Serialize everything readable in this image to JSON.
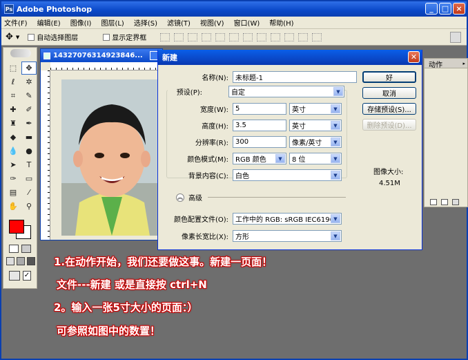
{
  "app": {
    "title": "Adobe Photoshop",
    "window_buttons": [
      "_",
      "□",
      "×"
    ]
  },
  "menu": [
    "文件(F)",
    "编辑(E)",
    "图像(I)",
    "图层(L)",
    "选择(S)",
    "滤镜(T)",
    "视图(V)",
    "窗口(W)",
    "帮助(H)"
  ],
  "options": {
    "auto_select": "自动选择图层",
    "show_bounds": "显示定界框"
  },
  "document": {
    "title": "14327076314923846..."
  },
  "panel": {
    "tab": "动作"
  },
  "dialog": {
    "title": "新建",
    "name_label": "名称(N):",
    "name_value": "未标题-1",
    "preset_label": "预设(P):",
    "preset_value": "自定",
    "width_label": "宽度(W):",
    "width_value": "5",
    "width_unit": "英寸",
    "height_label": "高度(H):",
    "height_value": "3.5",
    "height_unit": "英寸",
    "res_label": "分辨率(R):",
    "res_value": "300",
    "res_unit": "像素/英寸",
    "mode_label": "颜色模式(M):",
    "mode_value": "RGB 颜色",
    "mode_bits": "8 位",
    "bg_label": "背景内容(C):",
    "bg_value": "白色",
    "advanced_label": "高级",
    "profile_label": "颜色配置文件(O):",
    "profile_value": "工作中的 RGB: sRGB IEC6196...",
    "aspect_label": "像素长宽比(X):",
    "aspect_value": "方形",
    "ok": "好",
    "cancel": "取消",
    "save_preset": "存储预设(S)...",
    "delete_preset": "删除预设(D)...",
    "image_size_label": "图像大小:",
    "image_size_value": "4.51M"
  },
  "annotations": [
    "1.在动作开始，我们还要做这事。新建一页面！",
    "文件---新建 或是直接按 ctrl+N",
    "2。输入一张5寸大小的页面：）",
    "可参照如图中的数置！"
  ],
  "colors": {
    "foreground": "#ff0000",
    "background": "#ffffff",
    "titlebar": "#0a48c8"
  }
}
